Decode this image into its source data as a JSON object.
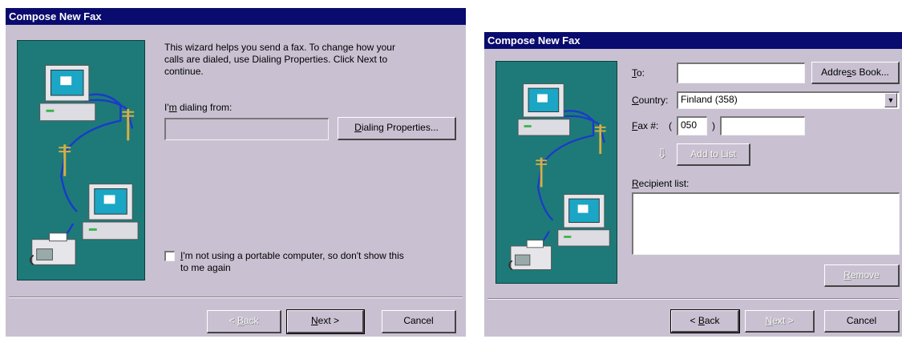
{
  "wizard_welcome": {
    "title": "Compose New Fax",
    "intro_line1": "This wizard helps you send a fax. To change how your",
    "intro_line2": "calls are dialed, use Dialing Properties. Click Next to",
    "intro_line3": "continue.",
    "dialing_from_label_pre": "I'",
    "dialing_from_label_key": "m",
    "dialing_from_label_post": " dialing from:",
    "dialing_from_value": "",
    "dialing_properties_key": "D",
    "dialing_properties_rest": "ialing Properties...",
    "checkbox_key": "I",
    "checkbox_line1_rest": "'m not using a portable computer, so don't show this",
    "checkbox_line2": "to me again",
    "checkbox_checked": false,
    "back_prefix": "< ",
    "back_key": "B",
    "back_rest": "ack",
    "next_key": "N",
    "next_rest": "ext >",
    "cancel_label": "Cancel"
  },
  "wizard_recipient": {
    "title": "Compose New Fax",
    "to_key": "T",
    "to_rest": "o:",
    "to_value": "",
    "address_book_pre": "Addre",
    "address_book_key": "s",
    "address_book_post": "s Book...",
    "country_key": "C",
    "country_rest": "ountry:",
    "country_value": "Finland (358)",
    "fax_key": "F",
    "fax_rest": "ax #:",
    "paren_open": "(",
    "area_code": "050",
    "paren_close": ")",
    "fax_number": "",
    "add_to_list_label": "Add to List",
    "recipient_list_key": "R",
    "recipient_list_rest": "ecipient list:",
    "remove_key": "R",
    "remove_rest": "emove",
    "back_prefix": "< ",
    "back_key": "B",
    "back_rest": "ack",
    "next_key": "N",
    "next_rest": "ext >",
    "cancel_label": "Cancel"
  },
  "colors": {
    "titlebar": "#0a0b6e",
    "dialog_face": "#c9c1d2",
    "illustration_bg": "#1e7a78"
  },
  "icons": [
    "computer-icon",
    "fax-machine-icon",
    "telephone-pole-icon",
    "down-arrow-icon",
    "dropdown-arrow-icon"
  ]
}
